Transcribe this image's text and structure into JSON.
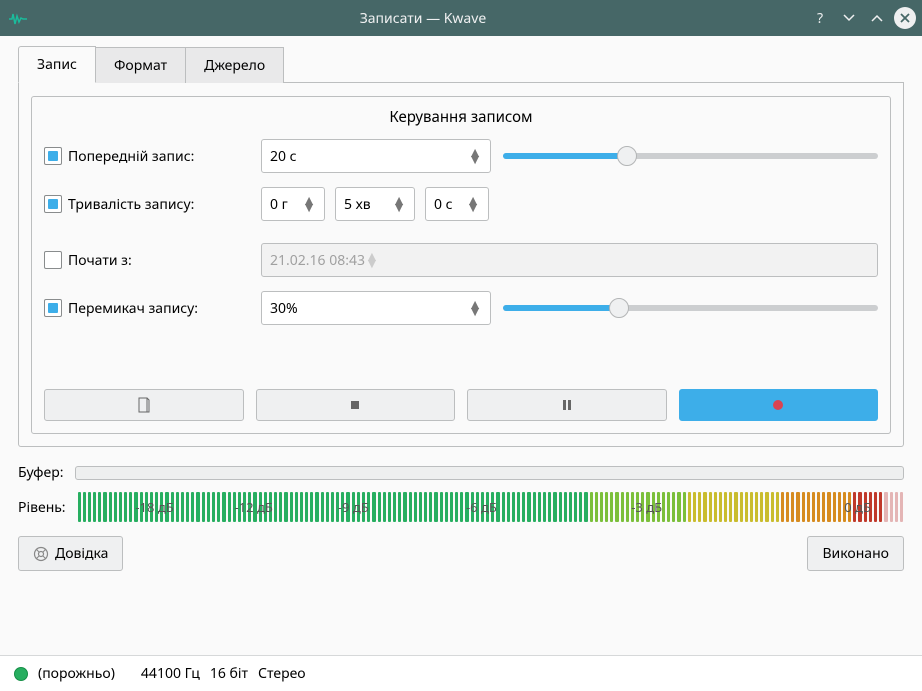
{
  "window": {
    "title": "Записати — Kwave"
  },
  "tabs": {
    "record": "Запис",
    "format": "Формат",
    "source": "Джерело"
  },
  "group": {
    "title": "Керування записом"
  },
  "prerecord": {
    "label": "Попередній запис:",
    "value": "20 с",
    "slider_pct": 33
  },
  "duration": {
    "label": "Тривалість запису:",
    "h": "0 г",
    "m": "5 хв",
    "s": "0 с"
  },
  "start": {
    "label": "Почати з:",
    "value": "21.02.16 08:43"
  },
  "trigger": {
    "label": "Перемикач запису:",
    "value": "30%",
    "slider_pct": 31
  },
  "buffer": {
    "label": "Буфер:"
  },
  "level": {
    "label": "Рівень:",
    "marks": [
      "-18 дБ",
      "-12 дБ",
      "-9 дБ",
      "-6 дБ",
      "-3 дБ",
      "0 дБ"
    ],
    "mark_pos": [
      7,
      19,
      31.5,
      47,
      67,
      96
    ]
  },
  "buttons": {
    "help": "Довідка",
    "done": "Виконано"
  },
  "status": {
    "state": "(порожньо)",
    "rate": "44100 Гц",
    "bits": "16 біт",
    "channels": "Стерео"
  },
  "icons": {
    "new": "new-icon",
    "stop": "stop-icon",
    "pause": "pause-icon",
    "record": "record-icon",
    "help": "help-lifebuoy-icon"
  }
}
